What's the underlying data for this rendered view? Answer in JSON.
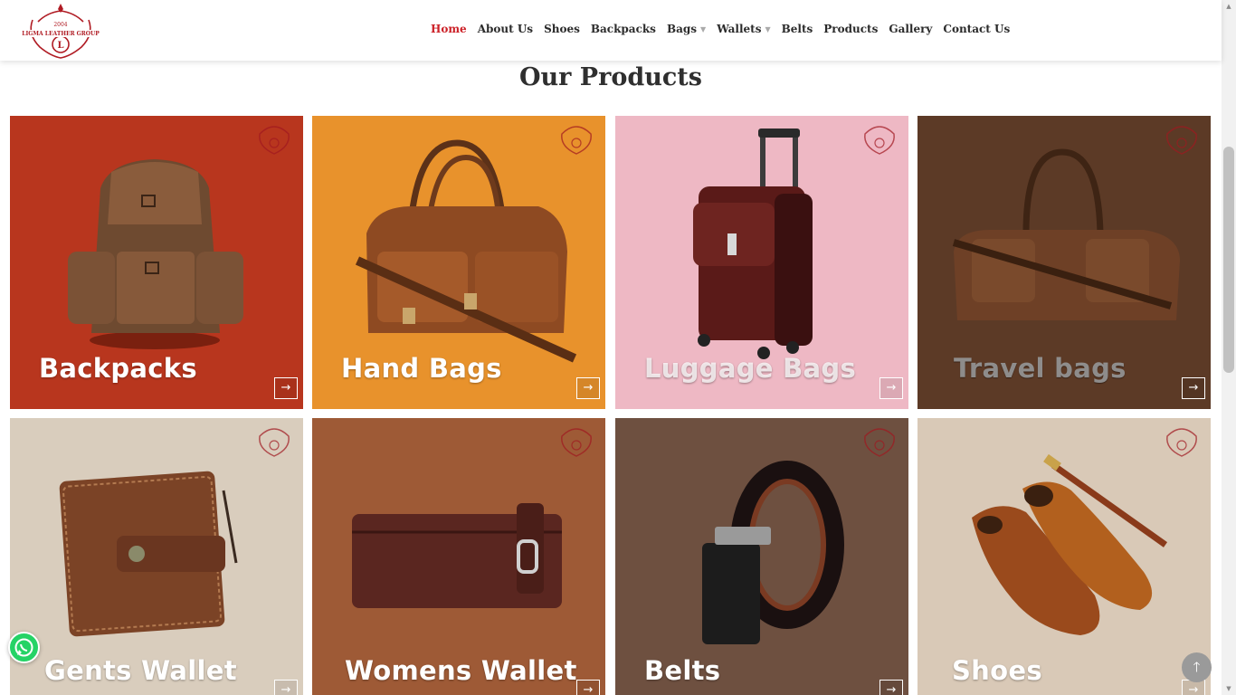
{
  "brand": {
    "logo_text": "LIGMA LEATHER GROUP",
    "logo_year": "2004",
    "logo_letter": "L",
    "accent_color": "#cc2027"
  },
  "nav": {
    "items": [
      {
        "label": "Home",
        "active": true,
        "has_dropdown": false
      },
      {
        "label": "About Us",
        "active": false,
        "has_dropdown": false
      },
      {
        "label": "Shoes",
        "active": false,
        "has_dropdown": false
      },
      {
        "label": "Backpacks",
        "active": false,
        "has_dropdown": false
      },
      {
        "label": "Bags",
        "active": false,
        "has_dropdown": true
      },
      {
        "label": "Wallets",
        "active": false,
        "has_dropdown": true
      },
      {
        "label": "Belts",
        "active": false,
        "has_dropdown": false
      },
      {
        "label": "Products",
        "active": false,
        "has_dropdown": false
      },
      {
        "label": "Gallery",
        "active": false,
        "has_dropdown": false
      },
      {
        "label": "Contact Us",
        "active": false,
        "has_dropdown": false
      }
    ],
    "dropdown_icon": "caret-down-icon"
  },
  "section": {
    "title": "Our Products"
  },
  "products": [
    {
      "label": "Backpacks",
      "icon": "backpack-image",
      "bg": "#b8361e"
    },
    {
      "label": "Hand Bags",
      "icon": "handbag-image",
      "bg": "#e8922c"
    },
    {
      "label": "Luggage Bags",
      "icon": "luggage-image",
      "bg": "#eeb8c4"
    },
    {
      "label": "Travel bags",
      "icon": "travel-bag-image",
      "bg": "#5c3a26"
    },
    {
      "label": "Gents Wallet",
      "icon": "wallet-image",
      "bg": "#d9cdbd"
    },
    {
      "label": "Womens Wallet",
      "icon": "womens-wallet-image",
      "bg": "#9e5a36"
    },
    {
      "label": "Belts",
      "icon": "belt-image",
      "bg": "#6e5040"
    },
    {
      "label": "Shoes",
      "icon": "shoes-image",
      "bg": "#d9c9b7"
    }
  ],
  "card_arrow": "→",
  "floating": {
    "whatsapp_icon": "whatsapp-icon",
    "back_to_top_icon": "arrow-up-icon",
    "back_to_top_glyph": "🡑"
  }
}
